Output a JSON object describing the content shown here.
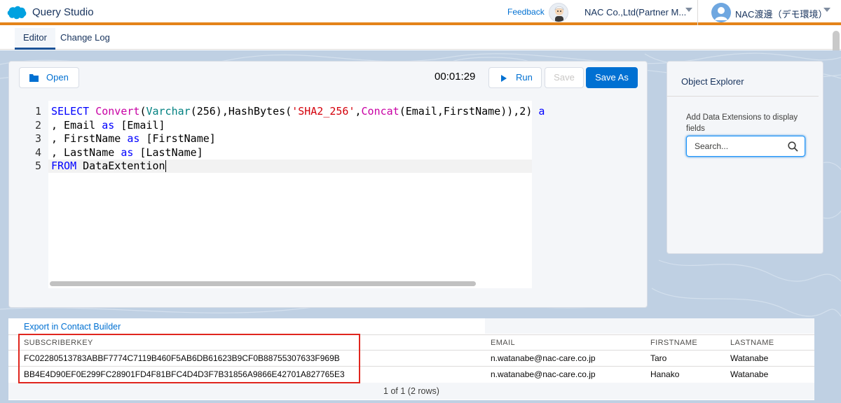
{
  "header": {
    "app_title": "Query Studio",
    "feedback": "Feedback",
    "org_name": "NAC Co.,Ltd(Partner M...",
    "user_name": "NAC渡邊（デモ環境）"
  },
  "tabs": [
    {
      "label": "Editor",
      "active": true
    },
    {
      "label": "Change Log",
      "active": false
    }
  ],
  "toolbar": {
    "open_label": "Open",
    "timer": "00:01:29",
    "run_label": "Run",
    "save_label": "Save",
    "save_as_label": "Save As"
  },
  "editor": {
    "line_numbers": [
      "1",
      "2",
      "3",
      "4",
      "5"
    ],
    "lines": [
      "SELECT Convert(Varchar(256),HashBytes('SHA2_256',Concat(Email,FirstName)),2) a",
      ", Email as [Email]",
      ", FirstName as [FirstName]",
      ", LastName as [LastName]",
      "FROM DataExtention"
    ]
  },
  "explorer": {
    "title": "Object Explorer",
    "hint": "Add Data Extensions to display fields",
    "search_placeholder": "Search..."
  },
  "results": {
    "export_link": "Export in Contact Builder",
    "columns": [
      "SUBSCRIBERKEY",
      "EMAIL",
      "FIRSTNAME",
      "LASTNAME"
    ],
    "rows": [
      [
        "FC02280513783ABBF7774C7119B460F5AB6DB61623B9CF0B88755307633F969B",
        "n.watanabe@nac-care.co.jp",
        "Taro",
        "Watanabe"
      ],
      [
        "BB4E4D90EF0E299FC28901FD4F81BFC4D4D3F7B31856A9866E42701A827765E3",
        "n.watanabe@nac-care.co.jp",
        "Hanako",
        "Watanabe"
      ]
    ],
    "pager": "1 of 1 (2 rows)"
  },
  "colors": {
    "accent": "#e4841a",
    "brand": "#0070d2",
    "highlight": "#e0261e"
  }
}
